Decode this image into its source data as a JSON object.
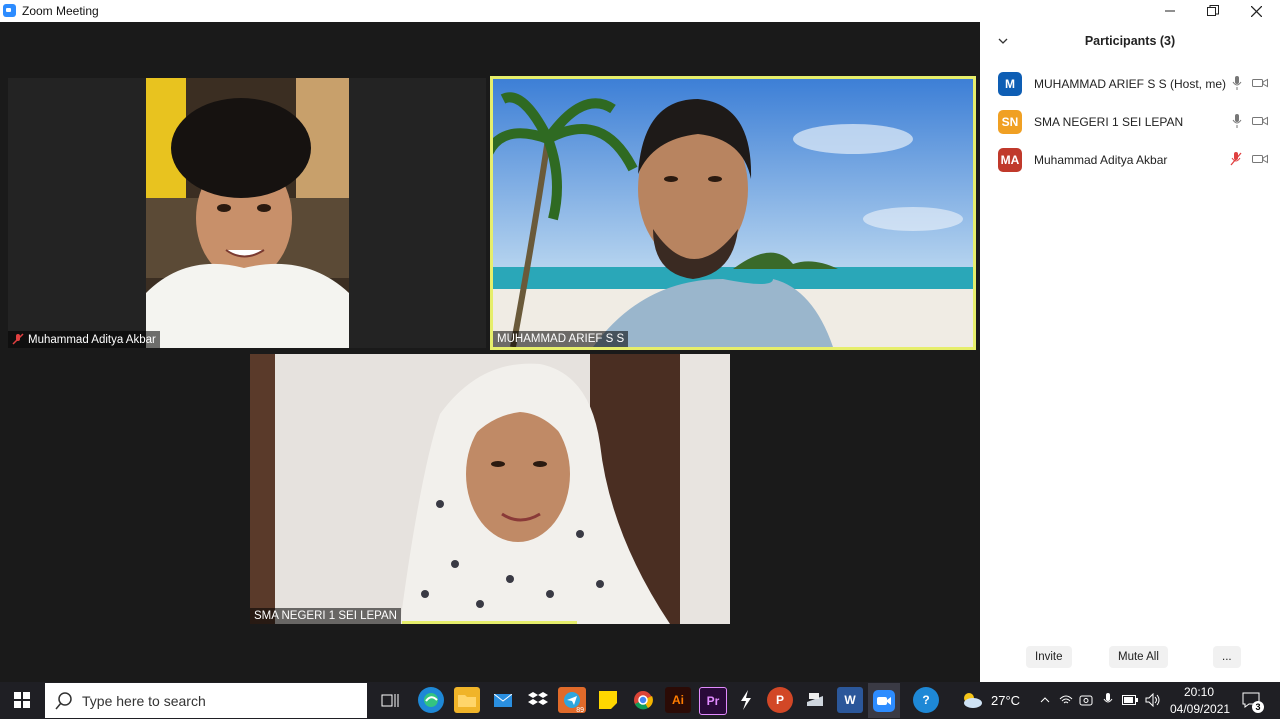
{
  "window": {
    "title": "Zoom Meeting",
    "minimize_icon": "minimize-icon",
    "restore_icon": "restore-icon",
    "close_icon": "close-icon"
  },
  "meeting": {
    "tiles": [
      {
        "name": "Muhammad Aditya Akbar",
        "muted": true,
        "active_speaker": false
      },
      {
        "name": "MUHAMMAD ARIEF S S",
        "muted": false,
        "active_speaker": true
      },
      {
        "name": "SMA NEGERI 1 SEI LEPAN",
        "muted": false,
        "active_speaker": false
      }
    ],
    "active_speaker_color": "#e6ee6b"
  },
  "participants": {
    "title": "Participants (3)",
    "list": [
      {
        "initials": "M",
        "name": "MUHAMMAD ARIEF S S (Host, me)",
        "color": "#0e5eb4",
        "mic": "mic-icon",
        "video": "video-icon"
      },
      {
        "initials": "SN",
        "name": "SMA NEGERI 1 SEI LEPAN",
        "color": "#f0a023",
        "mic": "mic-icon",
        "video": "video-icon"
      },
      {
        "initials": "MA",
        "name": "Muhammad Aditya Akbar",
        "color": "#c0392b",
        "mic": "mic-muted-icon",
        "video": "video-icon"
      }
    ],
    "invite_label": "Invite",
    "mute_all_label": "Mute All",
    "more_label": "..."
  },
  "taskbar": {
    "search_placeholder": "Type here to search",
    "weather": "27°C",
    "time": "20:10",
    "date": "04/09/2021",
    "notifications": "3",
    "telegram_badge": "89"
  }
}
